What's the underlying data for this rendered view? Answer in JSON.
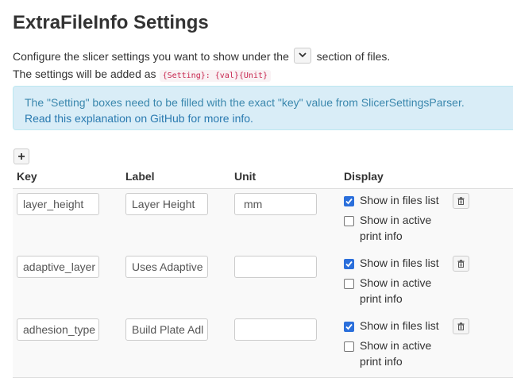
{
  "page": {
    "title": "ExtraFileInfo Settings",
    "desc_before": "Configure the slicer settings you want to show under the",
    "desc_after": "section of files.",
    "desc2": "The settings will be added as",
    "code": "{Setting}: {val}{Unit}",
    "icon_inline": "chevron-down-icon"
  },
  "alert": {
    "line1": "The \"Setting\" boxes need to be filled with the exact \"key\" value from SlicerSettingsParser.",
    "link_text": "Read this explanation on GitHub for more info."
  },
  "toolbar": {
    "add_label": "+"
  },
  "table": {
    "headers": {
      "key": "Key",
      "label": "Label",
      "unit": "Unit",
      "display": "Display"
    },
    "rows": [
      {
        "key": "layer_height",
        "label": "Layer Height",
        "unit": "mm",
        "show_files": true,
        "show_print": false
      },
      {
        "key": "adaptive_layer",
        "label": "Uses Adaptive",
        "unit": "",
        "show_files": true,
        "show_print": false
      },
      {
        "key": "adhesion_type",
        "label": "Build Plate Adl",
        "unit": "",
        "show_files": true,
        "show_print": false
      }
    ],
    "show_files_label": "Show in files list",
    "show_print_line1": "Show in active",
    "show_print_line2": "print info"
  },
  "colors": {
    "accent": "#2b6fdb",
    "alert_bg": "#d9edf7",
    "alert_text": "#3a87ad",
    "row_bg": "#f9f9f9"
  }
}
